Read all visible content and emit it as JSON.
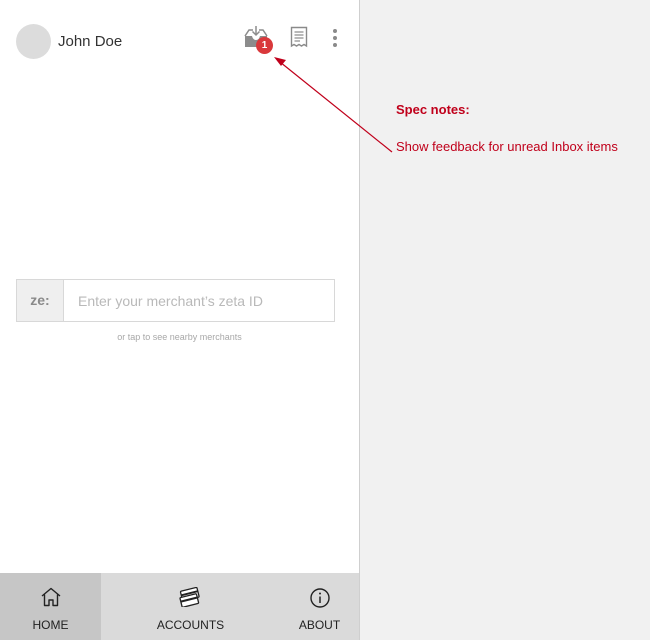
{
  "header": {
    "username": "John Doe",
    "inbox_badge": "1"
  },
  "icons": {
    "avatar": "avatar-placeholder",
    "inbox": "inbox-download-icon",
    "receipt": "receipt-icon",
    "more": "more-vert-icon",
    "home": "home-icon",
    "accounts": "cards-icon",
    "about": "info-icon"
  },
  "merchant": {
    "prefix": "ze:",
    "placeholder": "Enter your merchant’s zeta ID",
    "value": "",
    "hint": "or tap to see nearby merchants"
  },
  "nav": {
    "items": [
      {
        "label": "HOME",
        "selected": true
      },
      {
        "label": "ACCOUNTS",
        "selected": false
      },
      {
        "label": "ABOUT",
        "selected": false
      }
    ]
  },
  "spec": {
    "title": "Spec notes:",
    "body": "Show feedback for unread Inbox items"
  },
  "colors": {
    "annotation": "#c0001b",
    "badge": "#d9383b",
    "nav_bg": "#dadada",
    "nav_selected": "#c6c6c6"
  }
}
